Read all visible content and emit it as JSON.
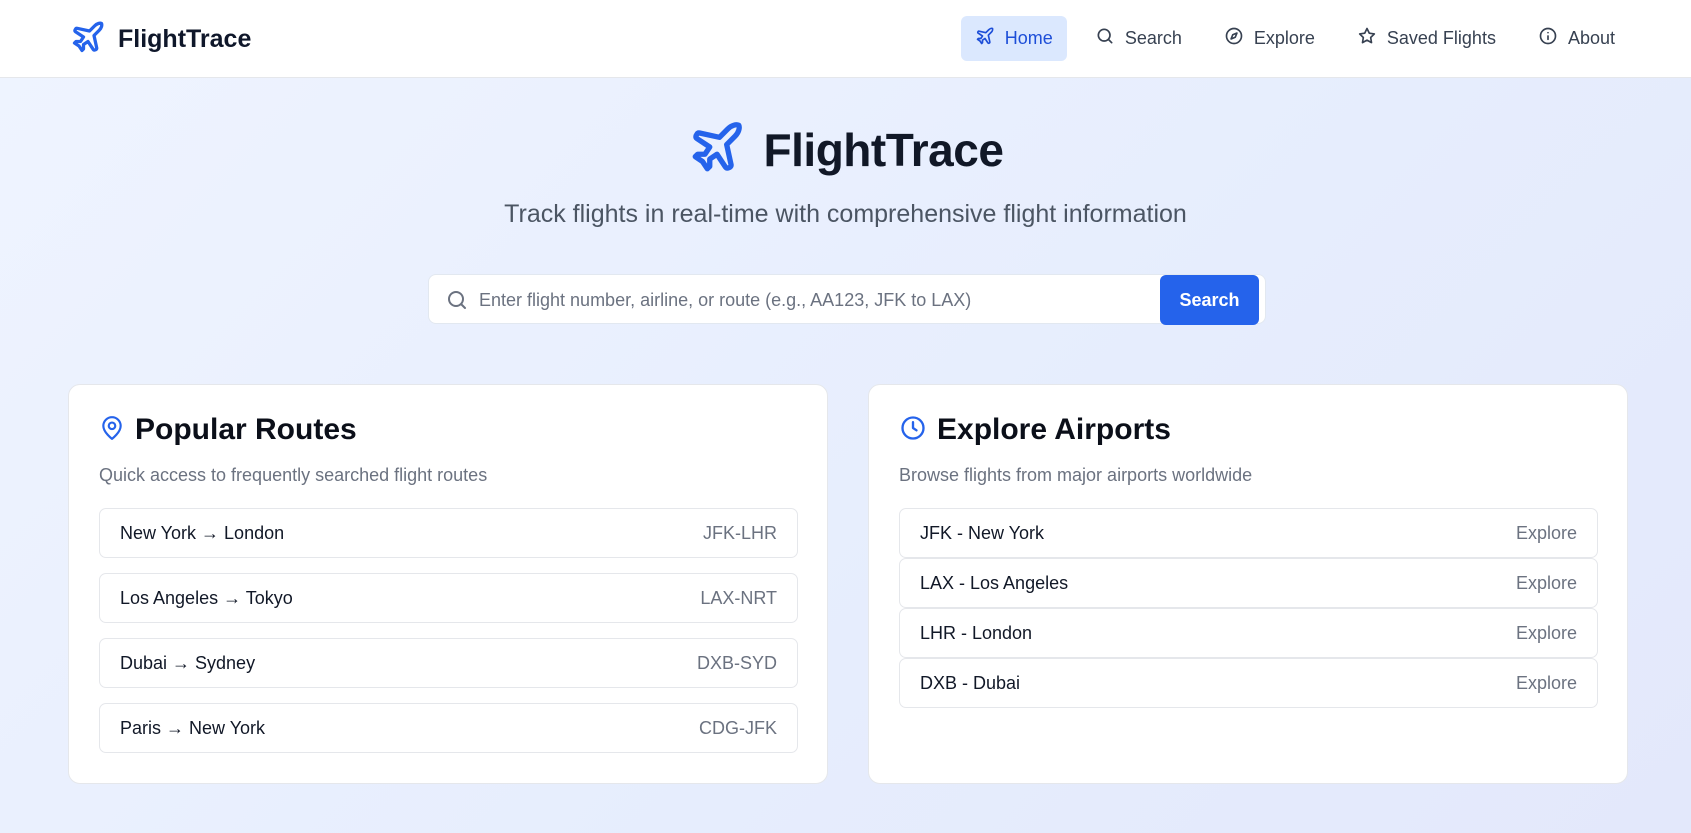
{
  "brand": {
    "name": "FlightTrace",
    "icon": "plane-icon",
    "accent": "#2563eb"
  },
  "nav": {
    "items": [
      {
        "label": "Home",
        "icon": "plane-icon",
        "active": true
      },
      {
        "label": "Search",
        "icon": "search-icon",
        "active": false
      },
      {
        "label": "Explore",
        "icon": "compass-icon",
        "active": false
      },
      {
        "label": "Saved Flights",
        "icon": "star-icon",
        "active": false
      },
      {
        "label": "About",
        "icon": "info-icon",
        "active": false
      }
    ]
  },
  "hero": {
    "title": "FlightTrace",
    "subtitle": "Track flights in real-time with comprehensive flight information"
  },
  "search": {
    "placeholder": "Enter flight number, airline, or route (e.g., AA123, JFK to LAX)",
    "value": "",
    "button_label": "Search"
  },
  "popular_routes": {
    "title": "Popular Routes",
    "icon": "map-pin-icon",
    "description": "Quick access to frequently searched flight routes",
    "items": [
      {
        "name": "New York → London",
        "code": "JFK-LHR"
      },
      {
        "name": "Los Angeles → Tokyo",
        "code": "LAX-NRT"
      },
      {
        "name": "Dubai → Sydney",
        "code": "DXB-SYD"
      },
      {
        "name": "Paris → New York",
        "code": "CDG-JFK"
      }
    ]
  },
  "explore_airports": {
    "title": "Explore Airports",
    "icon": "clock-icon",
    "description": "Browse flights from major airports worldwide",
    "items": [
      {
        "name": "JFK - New York",
        "action": "Explore"
      },
      {
        "name": "LAX - Los Angeles",
        "action": "Explore"
      },
      {
        "name": "LHR - London",
        "action": "Explore"
      },
      {
        "name": "DXB - Dubai",
        "action": "Explore"
      }
    ]
  }
}
